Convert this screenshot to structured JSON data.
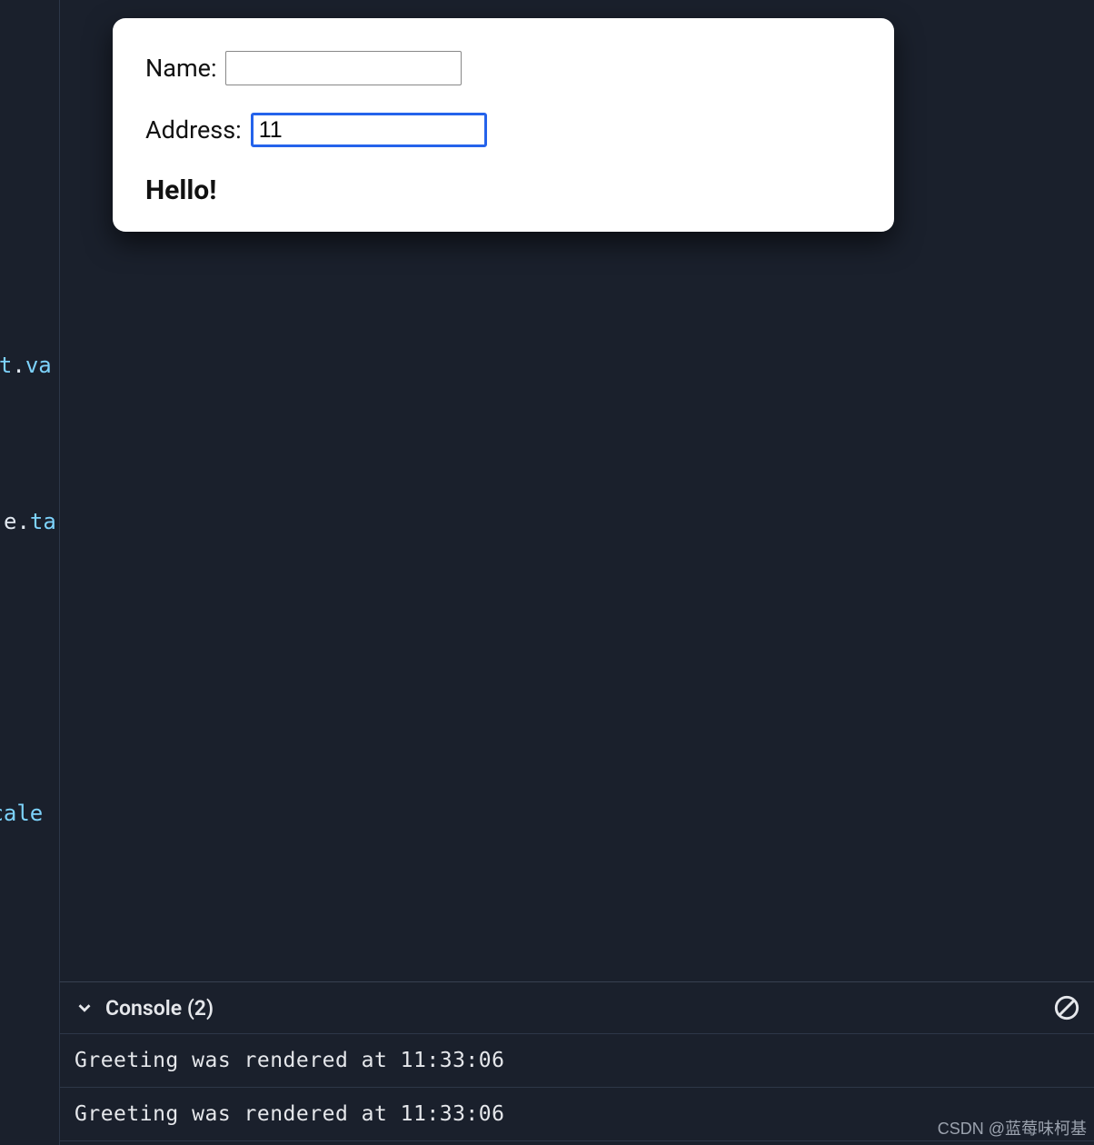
{
  "code_fragments": {
    "frag1_a": "get",
    "frag1_b": ".",
    "frag1_c": "va",
    "frag2_a": "e",
    "frag2_b": ".",
    "frag2_c": "ta",
    "frag3_a": "ocale"
  },
  "form": {
    "name_label": "Name:",
    "name_value": "",
    "address_label": "Address:",
    "address_value": "11",
    "greeting": "Hello!"
  },
  "console": {
    "title": "Console",
    "count": "(2)",
    "logs": [
      "Greeting was rendered at 11:33:06",
      "Greeting was rendered at 11:33:06"
    ]
  },
  "watermark": "CSDN @蓝莓味柯基"
}
